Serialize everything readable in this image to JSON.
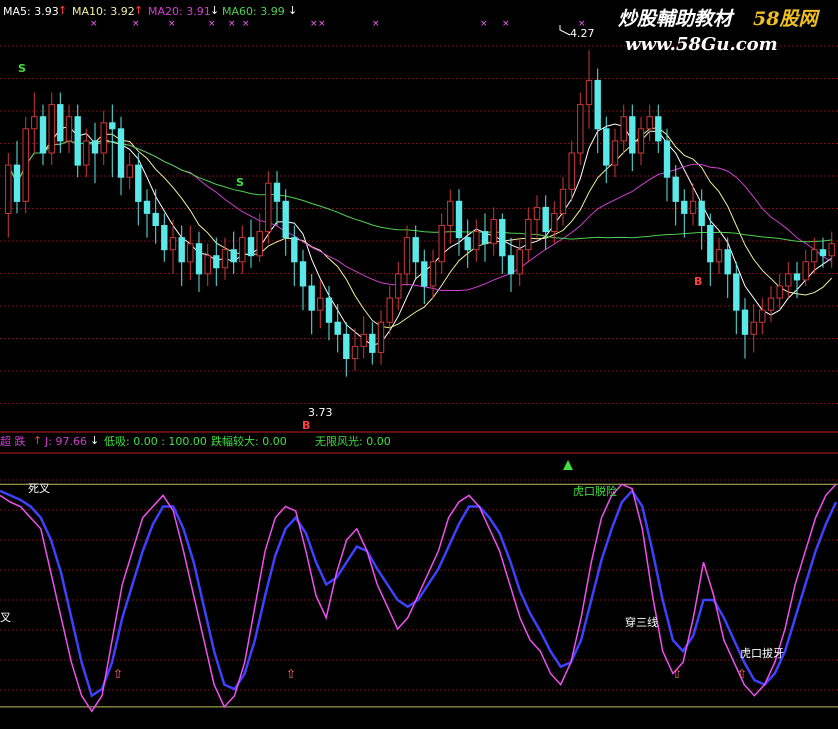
{
  "watermark": {
    "line1_cn": "炒股輔助教材",
    "line1_brand": "58股网",
    "line2": "www.58Gu.com"
  },
  "colors": {
    "bg": "#000000",
    "up_candle": "#c83838",
    "down_candle": "#5ae8e8",
    "ma5": "#ffffff",
    "ma10": "#f0f0a0",
    "ma20": "#d040d0",
    "ma60": "#50d050",
    "k_line": "#f050f0",
    "d_line": "#4040ff",
    "grid": "#7a1010",
    "level_line": "#c0c060",
    "signal_text": "#ffffff",
    "green_text": "#40e040",
    "pink_text": "#ff60ff",
    "red_text": "#ff4040"
  },
  "main_header": {
    "ma5_label": "MA5: 3.93",
    "ma10_label": "MA10: 3.92",
    "ma20_label": "MA20: 3.91",
    "ma60_label": "MA60: 3.99"
  },
  "sub_header": {
    "indicator": "超 跌",
    "j_label": "J: 97.66",
    "low_suck": "低吸: 0.00 : 100.00",
    "big_drop": "跌幅较大: 0.00",
    "unlimited": "无限风光: 0.00"
  },
  "annotations": {
    "high_price": "4.27",
    "low_price": "3.73",
    "sell_mark": "S",
    "buy_mark": "B",
    "dead_cross": "死叉",
    "tiger_escape": "虎口脱险",
    "through_three": "穿三线",
    "tiger_tooth": "虎口拔牙",
    "left_cut": "叉"
  },
  "chart_data": {
    "type": "candlestick",
    "ylim": [
      3.65,
      4.32
    ],
    "price_extremes": {
      "high": 4.27,
      "low": 3.73
    },
    "candles": [
      [
        4.0,
        4.08,
        3.96,
        4.1
      ],
      [
        4.08,
        4.02,
        4.0,
        4.12
      ],
      [
        4.02,
        4.14,
        4.0,
        4.16
      ],
      [
        4.14,
        4.16,
        4.1,
        4.2
      ],
      [
        4.16,
        4.1,
        4.08,
        4.18
      ],
      [
        4.1,
        4.18,
        4.08,
        4.2
      ],
      [
        4.18,
        4.12,
        4.1,
        4.2
      ],
      [
        4.12,
        4.16,
        4.1,
        4.18
      ],
      [
        4.16,
        4.08,
        4.06,
        4.18
      ],
      [
        4.08,
        4.12,
        4.06,
        4.14
      ],
      [
        4.12,
        4.1,
        4.05,
        4.15
      ],
      [
        4.1,
        4.15,
        4.08,
        4.17
      ],
      [
        4.15,
        4.14,
        4.06,
        4.18
      ],
      [
        4.14,
        4.06,
        4.03,
        4.16
      ],
      [
        4.06,
        4.08,
        4.04,
        4.1
      ],
      [
        4.08,
        4.02,
        3.98,
        4.1
      ],
      [
        4.02,
        4.0,
        3.96,
        4.04
      ],
      [
        4.0,
        3.98,
        3.95,
        4.04
      ],
      [
        3.98,
        3.94,
        3.92,
        4.0
      ],
      [
        3.94,
        3.96,
        3.9,
        3.99
      ],
      [
        3.96,
        3.92,
        3.88,
        3.98
      ],
      [
        3.92,
        3.95,
        3.89,
        3.98
      ],
      [
        3.95,
        3.9,
        3.87,
        3.97
      ],
      [
        3.9,
        3.93,
        3.88,
        3.95
      ],
      [
        3.93,
        3.91,
        3.88,
        3.96
      ],
      [
        3.91,
        3.94,
        3.89,
        3.96
      ],
      [
        3.94,
        3.92,
        3.9,
        3.97
      ],
      [
        3.92,
        3.96,
        3.9,
        3.98
      ],
      [
        3.96,
        3.93,
        3.91,
        3.99
      ],
      [
        3.93,
        3.97,
        3.92,
        4.0
      ],
      [
        3.97,
        4.05,
        3.95,
        4.07
      ],
      [
        4.05,
        4.02,
        3.98,
        4.07
      ],
      [
        4.02,
        3.96,
        3.93,
        4.04
      ],
      [
        3.96,
        3.92,
        3.88,
        3.98
      ],
      [
        3.92,
        3.88,
        3.84,
        3.94
      ],
      [
        3.88,
        3.84,
        3.8,
        3.9
      ],
      [
        3.84,
        3.86,
        3.81,
        3.89
      ],
      [
        3.86,
        3.82,
        3.79,
        3.88
      ],
      [
        3.82,
        3.8,
        3.77,
        3.85
      ],
      [
        3.8,
        3.76,
        3.73,
        3.82
      ],
      [
        3.76,
        3.78,
        3.74,
        3.81
      ],
      [
        3.78,
        3.8,
        3.76,
        3.83
      ],
      [
        3.8,
        3.77,
        3.75,
        3.82
      ],
      [
        3.77,
        3.82,
        3.75,
        3.84
      ],
      [
        3.82,
        3.86,
        3.8,
        3.88
      ],
      [
        3.86,
        3.9,
        3.84,
        3.92
      ],
      [
        3.9,
        3.96,
        3.88,
        3.98
      ],
      [
        3.96,
        3.92,
        3.89,
        3.98
      ],
      [
        3.92,
        3.88,
        3.85,
        3.94
      ],
      [
        3.88,
        3.92,
        3.86,
        3.94
      ],
      [
        3.92,
        3.98,
        3.9,
        4.0
      ],
      [
        3.98,
        4.02,
        3.95,
        4.04
      ],
      [
        4.02,
        3.96,
        3.93,
        4.04
      ],
      [
        3.96,
        3.94,
        3.91,
        3.99
      ],
      [
        3.94,
        3.97,
        3.92,
        3.99
      ],
      [
        3.97,
        3.95,
        3.92,
        4.0
      ],
      [
        3.95,
        3.99,
        3.93,
        4.01
      ],
      [
        3.99,
        3.93,
        3.9,
        4.0
      ],
      [
        3.93,
        3.9,
        3.87,
        3.96
      ],
      [
        3.9,
        3.94,
        3.88,
        3.96
      ],
      [
        3.94,
        3.99,
        3.92,
        4.01
      ],
      [
        3.99,
        4.01,
        3.96,
        4.03
      ],
      [
        4.01,
        3.97,
        3.94,
        4.03
      ],
      [
        3.97,
        4.0,
        3.95,
        4.02
      ],
      [
        4.0,
        4.04,
        3.98,
        4.06
      ],
      [
        4.04,
        4.1,
        4.02,
        4.12
      ],
      [
        4.1,
        4.18,
        4.08,
        4.2
      ],
      [
        4.18,
        4.22,
        4.14,
        4.27
      ],
      [
        4.22,
        4.14,
        4.1,
        4.24
      ],
      [
        4.14,
        4.08,
        4.05,
        4.16
      ],
      [
        4.08,
        4.12,
        4.06,
        4.14
      ],
      [
        4.12,
        4.16,
        4.1,
        4.18
      ],
      [
        4.16,
        4.1,
        4.07,
        4.18
      ],
      [
        4.1,
        4.14,
        4.08,
        4.16
      ],
      [
        4.14,
        4.16,
        4.12,
        4.18
      ],
      [
        4.16,
        4.12,
        4.1,
        4.18
      ],
      [
        4.12,
        4.06,
        4.02,
        4.14
      ],
      [
        4.06,
        4.02,
        3.98,
        4.08
      ],
      [
        4.02,
        4.0,
        3.96,
        4.04
      ],
      [
        4.0,
        4.02,
        3.98,
        4.05
      ],
      [
        4.02,
        3.98,
        3.94,
        4.04
      ],
      [
        3.98,
        3.92,
        3.88,
        4.0
      ],
      [
        3.92,
        3.94,
        3.9,
        3.96
      ],
      [
        3.94,
        3.9,
        3.86,
        3.96
      ],
      [
        3.9,
        3.84,
        3.8,
        3.92
      ],
      [
        3.84,
        3.8,
        3.76,
        3.86
      ],
      [
        3.8,
        3.82,
        3.77,
        3.85
      ],
      [
        3.82,
        3.84,
        3.8,
        3.86
      ],
      [
        3.84,
        3.86,
        3.82,
        3.88
      ],
      [
        3.86,
        3.88,
        3.84,
        3.9
      ],
      [
        3.88,
        3.9,
        3.86,
        3.92
      ],
      [
        3.9,
        3.89,
        3.86,
        3.92
      ],
      [
        3.89,
        3.92,
        3.88,
        3.94
      ],
      [
        3.92,
        3.94,
        3.9,
        3.96
      ],
      [
        3.94,
        3.93,
        3.91,
        3.96
      ],
      [
        3.93,
        3.95,
        3.91,
        3.97
      ]
    ],
    "ma_values": {
      "MA5": 3.93,
      "MA10": 3.92,
      "MA20": 3.91,
      "MA60": 3.99
    },
    "oscillator": {
      "ylim": [
        -5,
        110
      ],
      "upper_level": 100,
      "lower_level": 0,
      "K": [
        95,
        92,
        90,
        85,
        80,
        60,
        40,
        20,
        5,
        -2,
        5,
        30,
        55,
        70,
        85,
        90,
        95,
        88,
        70,
        50,
        30,
        10,
        0,
        5,
        20,
        45,
        70,
        85,
        90,
        88,
        70,
        50,
        40,
        60,
        75,
        80,
        70,
        55,
        45,
        35,
        40,
        50,
        60,
        70,
        85,
        92,
        95,
        90,
        80,
        70,
        55,
        40,
        30,
        25,
        15,
        10,
        20,
        40,
        65,
        85,
        95,
        100,
        98,
        80,
        50,
        25,
        15,
        20,
        40,
        65,
        50,
        30,
        20,
        10,
        5,
        10,
        20,
        35,
        55,
        70,
        85,
        95,
        100
      ],
      "D": [
        97,
        95,
        93,
        90,
        85,
        75,
        60,
        40,
        20,
        5,
        8,
        20,
        40,
        55,
        70,
        82,
        90,
        90,
        80,
        65,
        45,
        25,
        10,
        8,
        15,
        30,
        50,
        68,
        80,
        85,
        78,
        65,
        55,
        58,
        65,
        72,
        70,
        62,
        55,
        48,
        45,
        48,
        55,
        62,
        72,
        82,
        90,
        90,
        85,
        78,
        66,
        52,
        42,
        34,
        25,
        18,
        20,
        30,
        48,
        66,
        80,
        92,
        97,
        90,
        70,
        48,
        30,
        25,
        32,
        48,
        48,
        40,
        30,
        20,
        12,
        10,
        15,
        25,
        40,
        55,
        70,
        82,
        92
      ]
    },
    "signals": {
      "sell_points": [
        "S",
        "S"
      ],
      "buy_points": [
        "B",
        "B"
      ],
      "oscillator_labels": [
        "死叉",
        "虎口脱险",
        "穿三线",
        "虎口拔牙"
      ]
    }
  }
}
